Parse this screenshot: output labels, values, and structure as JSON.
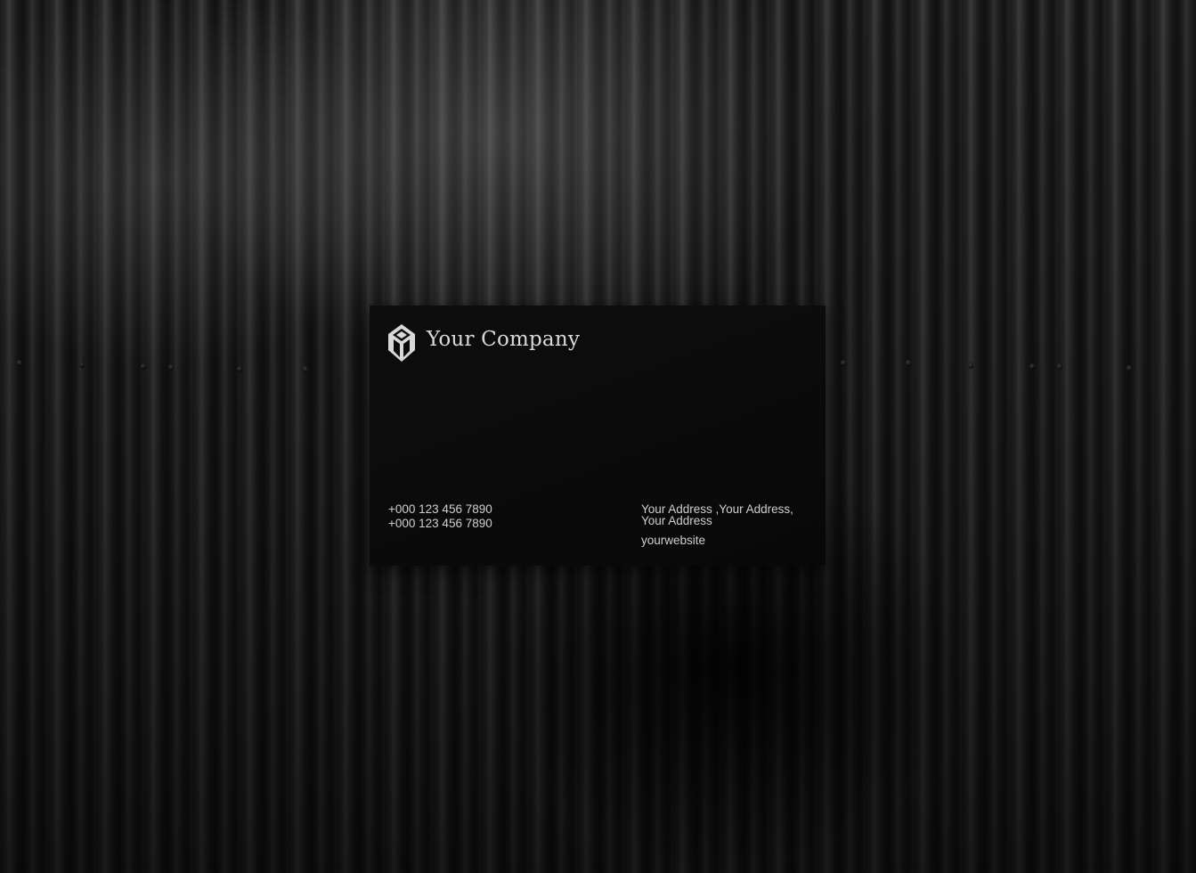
{
  "card": {
    "company_name": "Your Company",
    "phones": [
      "+000 123 456 7890",
      "+000 123 456 7890"
    ],
    "address": "Your Address ,Your Address, Your Address",
    "website": "yourwebsite",
    "logo_icon": "company-logo-icon"
  },
  "colors": {
    "card_background": "#0b0b0b",
    "text": "#cfcfcf",
    "wall": "#1c1c1c"
  }
}
